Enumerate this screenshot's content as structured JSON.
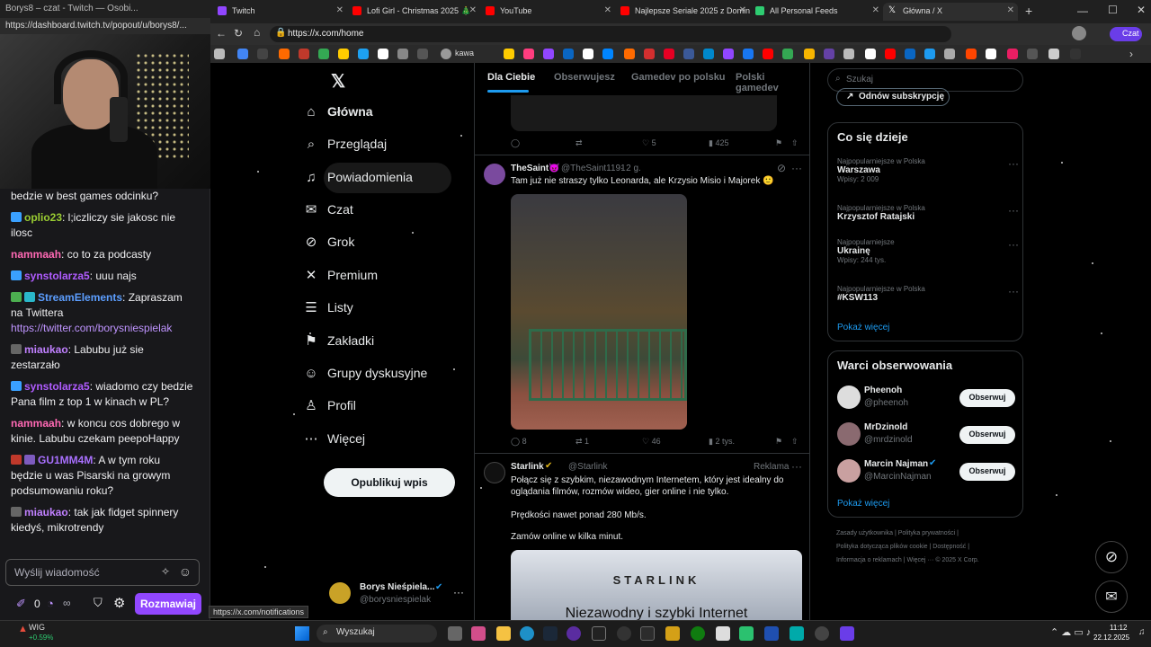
{
  "twitch": {
    "window_title": "Borys8 – czat - Twitch — Osobi...",
    "url": "https://dashboard.twitch.tv/popout/u/borys8/...",
    "chat": [
      {
        "user": "",
        "text": "bedzie w best games odcinku?",
        "color": "#efeff1"
      },
      {
        "user": "oplio23",
        "text": ": l;iczliczy sie jakosc nie ilosc",
        "color": "#9acd32"
      },
      {
        "user": "nammaah",
        "text": ": co to za podcasty",
        "color": "#ff69b4"
      },
      {
        "user": "synstolarza5",
        "text": ": uuu najs",
        "color": "#b05cff"
      },
      {
        "user": "StreamElements",
        "text": ": Zapraszam na Twittera",
        "link": "https://twitter.com/borysniespielak",
        "color": "#5c9eff"
      },
      {
        "user": "miaukao",
        "text": ": Labubu już sie zestarzało",
        "color": "#c080ff"
      },
      {
        "user": "synstolarza5",
        "text": ": wiadomo czy bedzie Pana film z top 1 w kinach w PL?",
        "color": "#b05cff"
      },
      {
        "user": "nammaah",
        "text": ": w koncu cos dobrego w kinie. Labubu czekam peepoHappy",
        "color": "#ff69b4"
      },
      {
        "user": "GU1MM4M",
        "text": ": A w tym roku będzie u was Pisarski na growym podsumowaniu roku?",
        "color": "#a970ff"
      },
      {
        "user": "miaukao",
        "text": ": tak jak fidget spinnery kiedyś, mikrotrendy",
        "color": "#c080ff"
      }
    ],
    "input_placeholder": "Wyślij wiadomość",
    "points": "0",
    "chat_button": "Rozmawiaj"
  },
  "browser": {
    "tabs": [
      {
        "label": "Twitch",
        "color": "#9146ff"
      },
      {
        "label": "Lofi Girl - Christmas 2025 🎄",
        "color": "#ff0000"
      },
      {
        "label": "YouTube",
        "color": "#ff0000"
      },
      {
        "label": "Najlepsze Seriale 2025 z Dominik...",
        "color": "#ff0000"
      },
      {
        "label": "All Personal Feeds",
        "color": "#2ecc71"
      },
      {
        "label": "Główna / X",
        "color": "#ffffff"
      }
    ],
    "url": "https://x.com/home",
    "profile_label": "Czat",
    "bookmark_label": "kawa",
    "status_url": "https://x.com/notifications"
  },
  "x": {
    "nav": [
      {
        "label": "Główna",
        "icon": "home-icon",
        "glyph": "⌂"
      },
      {
        "label": "Przeglądaj",
        "icon": "search-icon",
        "glyph": "⌕"
      },
      {
        "label": "Powiadomienia",
        "icon": "bell-icon",
        "glyph": "♫"
      },
      {
        "label": "Czat",
        "icon": "mail-icon",
        "glyph": "✉"
      },
      {
        "label": "Grok",
        "icon": "grok-icon",
        "glyph": "⊘"
      },
      {
        "label": "Premium",
        "icon": "x-logo-icon",
        "glyph": "✕"
      },
      {
        "label": "Listy",
        "icon": "list-icon",
        "glyph": "☰"
      },
      {
        "label": "Zakładki",
        "icon": "bookmark-icon",
        "glyph": "⚑"
      },
      {
        "label": "Grupy dyskusyjne",
        "icon": "people-icon",
        "glyph": "☺"
      },
      {
        "label": "Profil",
        "icon": "profile-icon",
        "glyph": "♙"
      },
      {
        "label": "Więcej",
        "icon": "more-icon",
        "glyph": "⋯"
      }
    ],
    "publish": "Opublikuj wpis",
    "account": {
      "name": "Borys Nieśpiela...",
      "handle": "@borysniespielak"
    },
    "feed_tabs": [
      "Dla Ciebie",
      "Obserwujesz",
      "Gamedev po polsku",
      "Polski gamedev"
    ],
    "post0_actions": {
      "likes": "5",
      "views": "425"
    },
    "post1": {
      "name": "TheSaint😈",
      "handle": "@TheSaint1191",
      "time": "· 2 g.",
      "text": "Tam już nie straszy tylko Leonarda, ale Krzysio Misio i Majorek 🙂",
      "replies": "8",
      "reposts": "1",
      "likes": "46",
      "views": "2 tys."
    },
    "post2": {
      "name": "Starlink",
      "handle": "@Starlink",
      "ad": "Reklama",
      "text1": "Połącz się z szybkim, niezawodnym Internetem, który jest idealny do oglądania filmów, rozmów wideo, gier online i nie tylko.",
      "text2": "Prędkości nawet ponad 280 Mb/s.",
      "text3": "Zamów online w kilka minut.",
      "banner_brand": "STARLINK",
      "banner_text": "Niezawodny i szybki Internet"
    },
    "search_placeholder": "Szukaj",
    "renew": "Odnów subskrypcję",
    "trends_title": "Co się dzieje",
    "trends": [
      {
        "cat": "Najpopularniejsze w Polska",
        "name": "Warszawa",
        "count": "Wpisy: 2 009"
      },
      {
        "cat": "Najpopularniejsze w Polska",
        "name": "Krzysztof Ratajski",
        "count": ""
      },
      {
        "cat": "Najpopularniejsze",
        "name": "Ukrainę",
        "count": "Wpisy: 244 tys."
      },
      {
        "cat": "Najpopularniejsze w Polska",
        "name": "#KSW113",
        "count": ""
      }
    ],
    "show_more": "Pokaż więcej",
    "wtf_title": "Warci obserwowania",
    "suggestions": [
      {
        "name": "Pheenoh",
        "handle": "@pheenoh"
      },
      {
        "name": "MrDzinold",
        "handle": "@mrdzinold"
      },
      {
        "name": "Marcin Najman",
        "handle": "@MarcinNajman"
      }
    ],
    "follow_label": "Obserwuj",
    "footer": [
      "Zasady użytkownika",
      "Polityka prywatności",
      "Polityka dotycząca plików cookie",
      "Dostępność",
      "Informacja o reklamach",
      "Więcej ···",
      "© 2025 X Corp."
    ]
  },
  "taskbar": {
    "widget_name": "WIG",
    "widget_value": "+0.59%",
    "search": "Wyszukaj",
    "time": "11:12",
    "date": "22.12.2025"
  }
}
